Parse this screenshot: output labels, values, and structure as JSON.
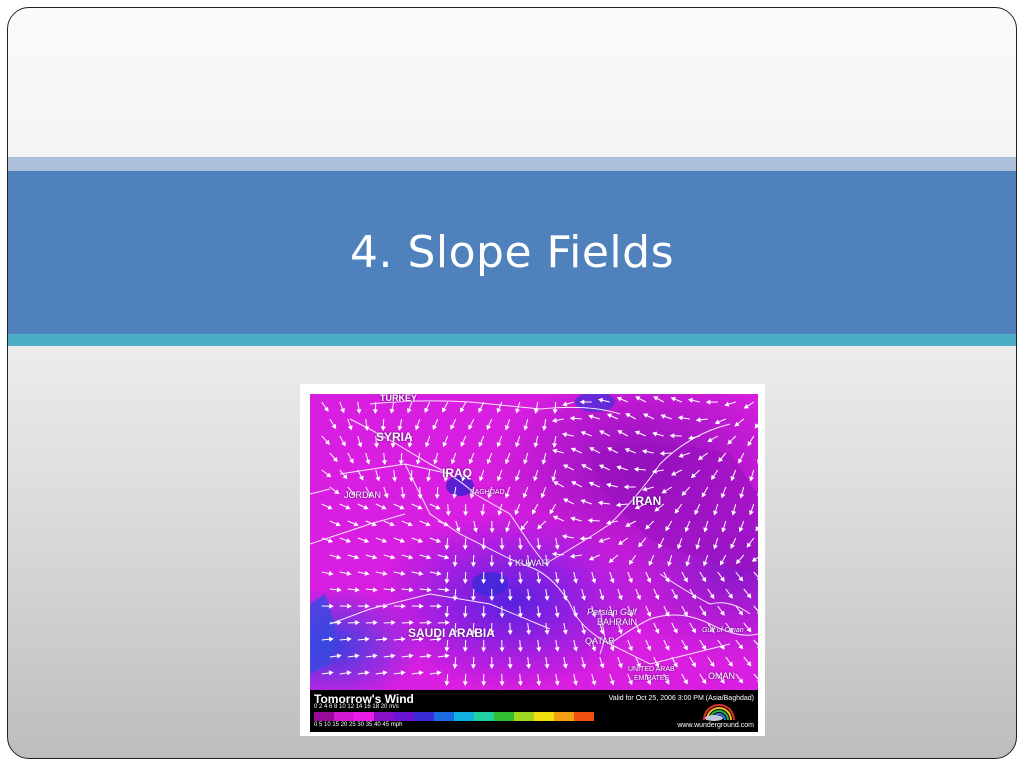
{
  "slide": {
    "title": "4.  Slope Fields"
  },
  "map": {
    "countries": [
      {
        "name": "TURKEY",
        "key": "turkey"
      },
      {
        "name": "SYRIA",
        "key": "syria"
      },
      {
        "name": "IRAQ",
        "key": "iraq"
      },
      {
        "name": "BAGHDAD",
        "key": "baghdad"
      },
      {
        "name": "JORDAN",
        "key": "jordan"
      },
      {
        "name": "IRAN",
        "key": "iran"
      },
      {
        "name": "KUWAIT",
        "key": "kuwait"
      },
      {
        "name": "Persian Gulf",
        "key": "gulf"
      },
      {
        "name": "BAHRAIN",
        "key": "bahrain"
      },
      {
        "name": "QATAR",
        "key": "qatar"
      },
      {
        "name": "SAUDI ARABIA",
        "key": "saudi"
      },
      {
        "name": "Gulf of Oman",
        "key": "gulfoman"
      },
      {
        "name": "UNITED ARAB",
        "key": "uae1"
      },
      {
        "name": "EMIRATES",
        "key": "uae2"
      },
      {
        "name": "OMAN",
        "key": "oman"
      }
    ],
    "colors": {
      "magenta": "#e020e6",
      "purple": "#8a10c8",
      "blue": "#3a2ad8"
    }
  },
  "legend": {
    "title": "Tomorrow's Wind",
    "valid": "Valid for Oct 25, 2006  3:00 PM (Asia/Baghdad)",
    "ms_scale": "0      2      4      6      8     10     12     14     16     18     20 m/s",
    "mph_scale": "0       5      10     15     20     25     30     35     40     45 mph",
    "site": "www.wunderground.com",
    "swatches": [
      "#9a0a9a",
      "#d418d4",
      "#e81ee8",
      "#8a10c8",
      "#6a14d4",
      "#3a2ad8",
      "#1a6ae0",
      "#10b0e0",
      "#20d0a0",
      "#30c030",
      "#a0d820",
      "#f0e010",
      "#f0a010",
      "#f05010"
    ]
  }
}
